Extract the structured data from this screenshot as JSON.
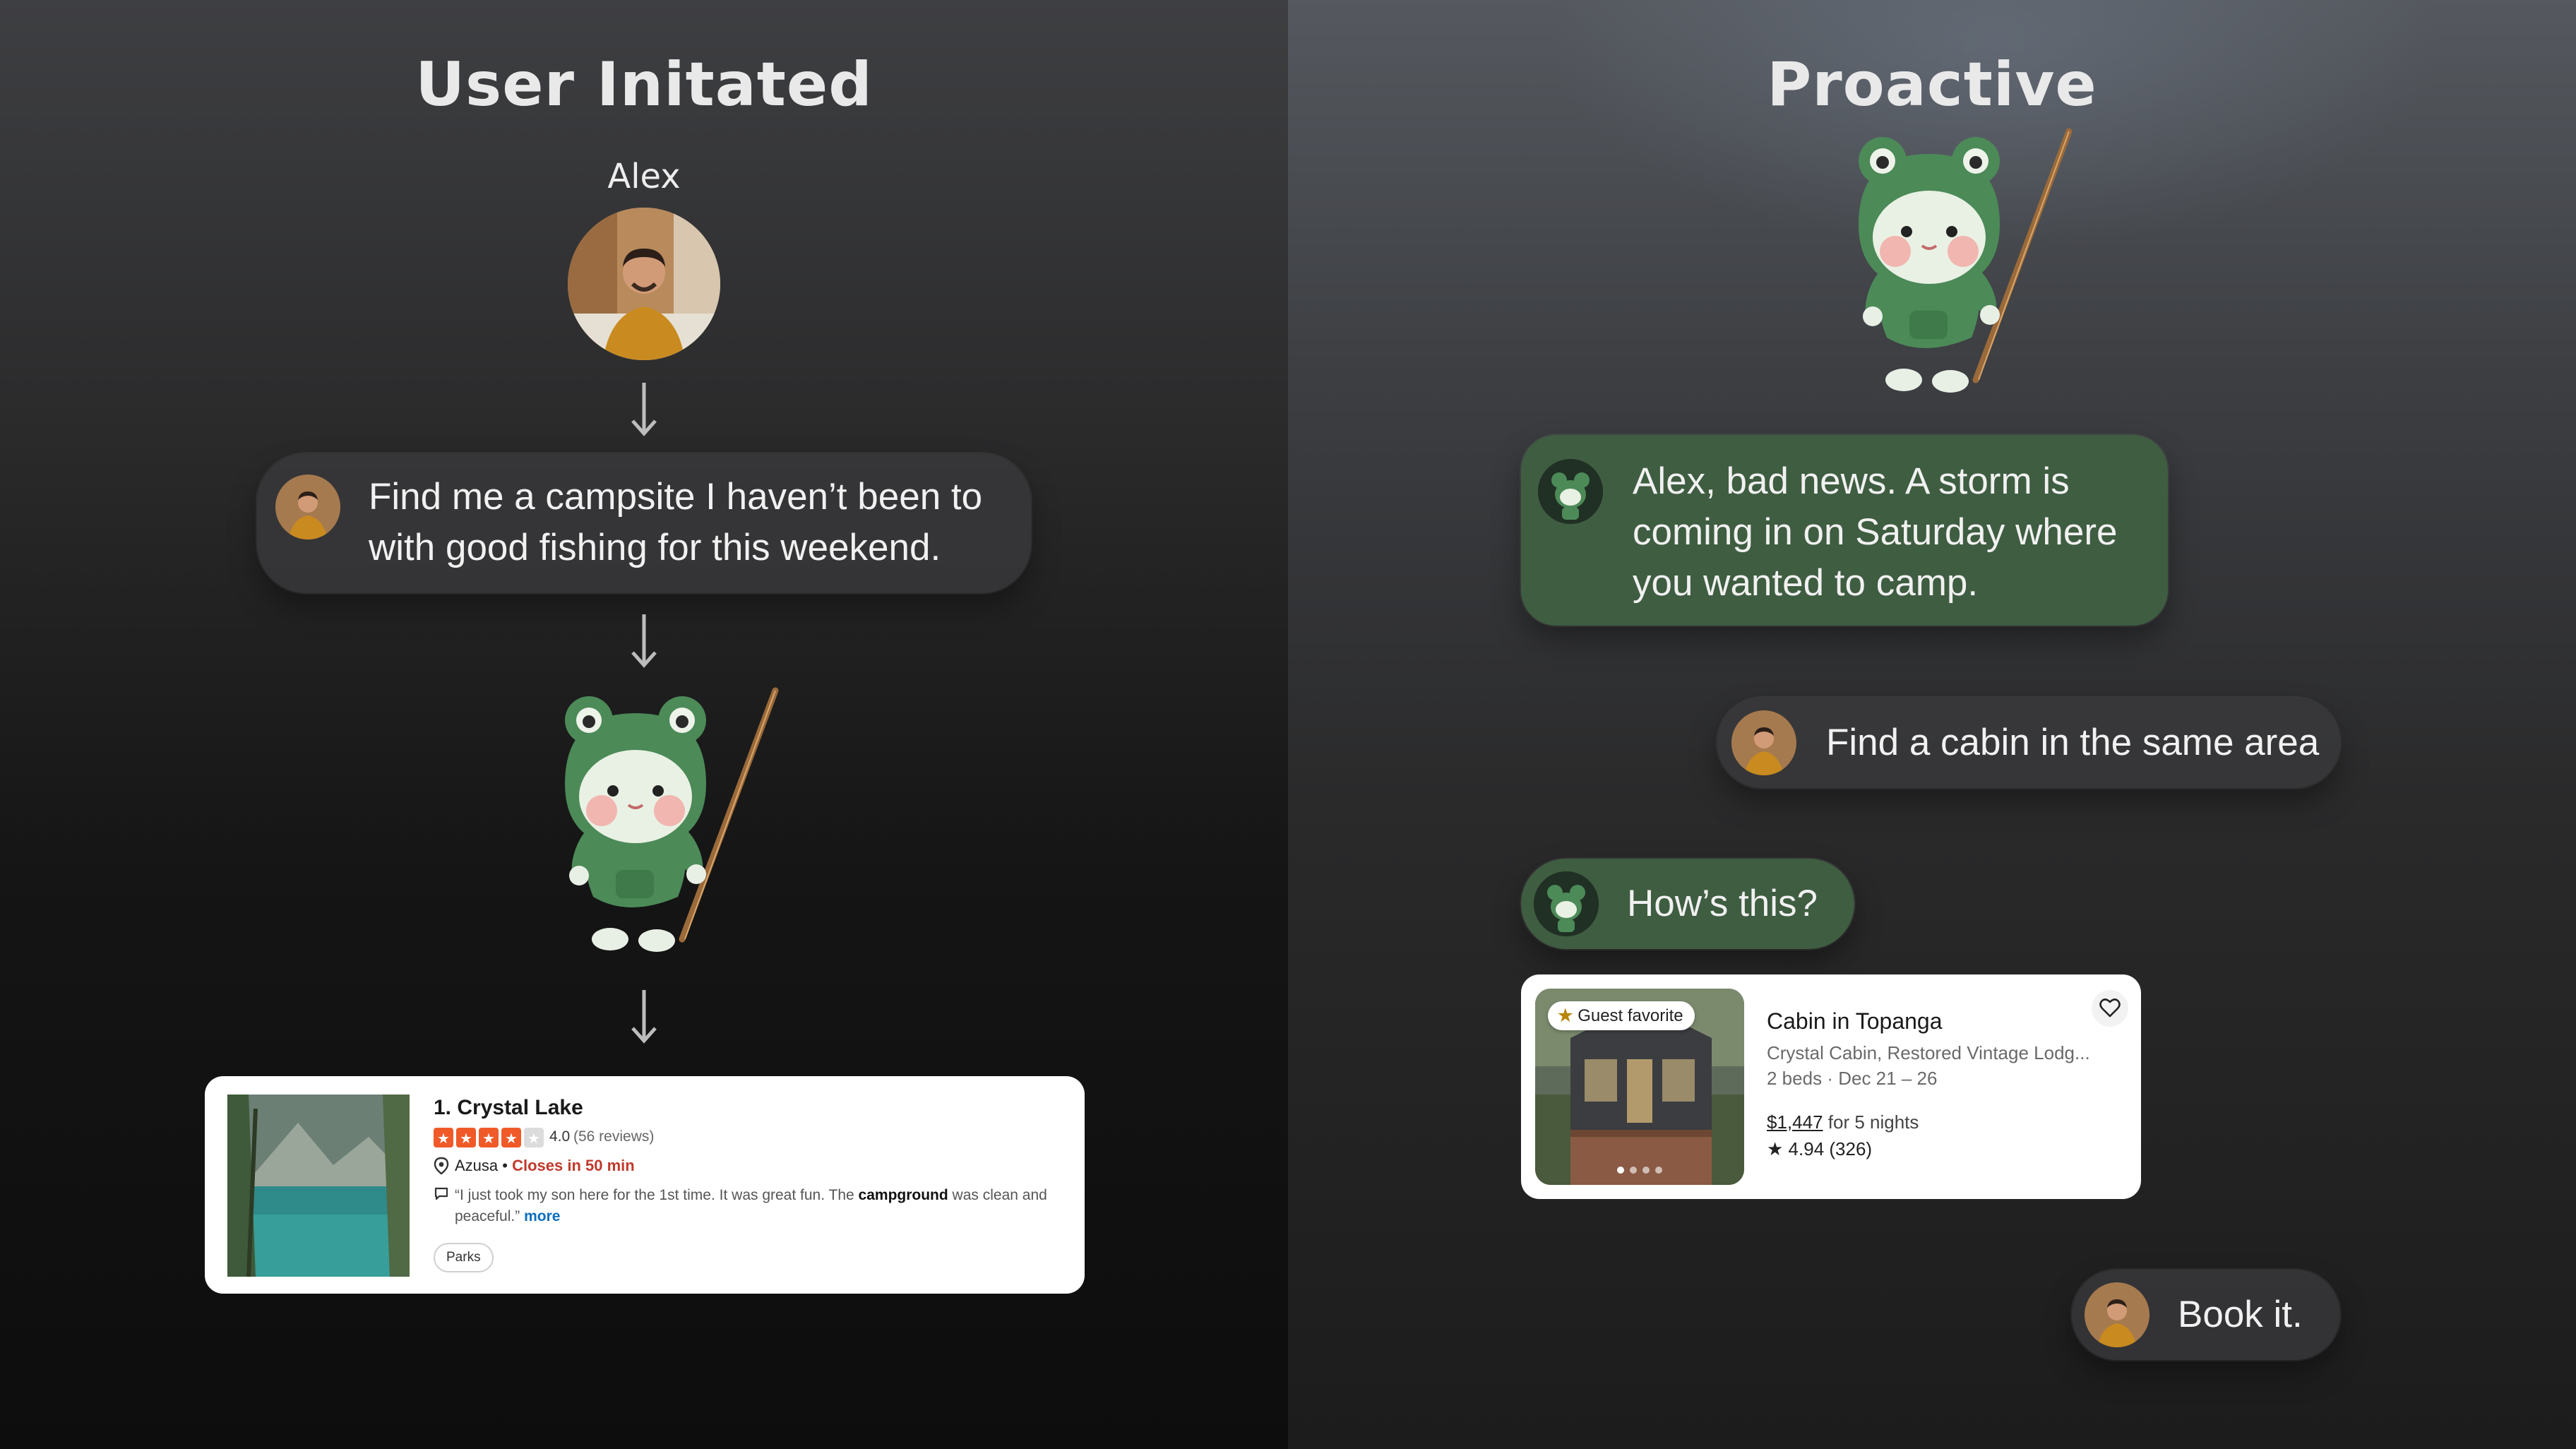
{
  "left": {
    "title": "User Initated",
    "user_name": "Alex",
    "user_message": "Find me a campsite I haven’t been to with good fishing for this weekend.",
    "result": {
      "name": "1. Crystal Lake",
      "rating": "4.0",
      "rating_stars": 4,
      "reviews": "(56 reviews)",
      "location": "Azusa",
      "separator": "•",
      "status": "Closes in 50 min",
      "review_text": "“I just took my son here for the 1st time. It was great fun. The ",
      "review_keyword": "campground",
      "review_text_2": " was clean and peaceful.”",
      "more": "more",
      "tag": "Parks"
    }
  },
  "right": {
    "title": "Proactive",
    "assistant_message_1": "Alex, bad news. A storm is coming in on Saturday where you wanted to camp.",
    "user_message_1": "Find a cabin in the same area",
    "assistant_message_2": "How’s this?",
    "listing": {
      "badge": "Guest favorite",
      "title": "Cabin in Topanga",
      "subtitle": "Crystal Cabin, Restored Vintage Lodg...",
      "beds": "2 beds",
      "dot": "·",
      "dates": "Dec 21 – 26",
      "price": "$1,447",
      "price_suffix": " for 5 nights",
      "rating": "4.94 (326)"
    },
    "user_message_2": "Book it."
  },
  "colors": {
    "assistant_bubble": "#3f5d41",
    "user_bubble": "#3a3a3c",
    "closes_red": "#c0392b",
    "star_orange": "#f05a28",
    "more_link": "#0a6ebd"
  }
}
